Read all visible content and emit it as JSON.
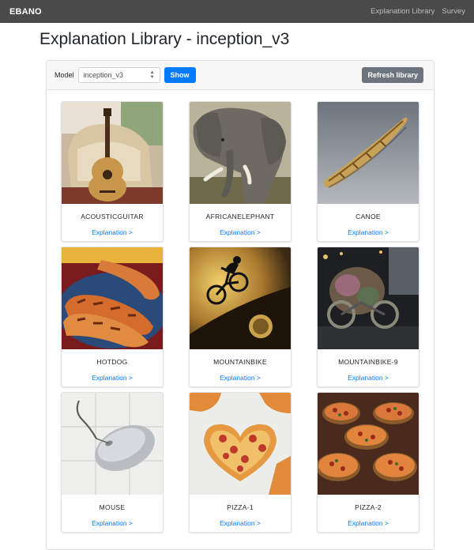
{
  "nav": {
    "brand": "EBANO",
    "links": [
      "Explanation Library",
      "Survey"
    ]
  },
  "page_title": "Explanation Library - inception_v3",
  "controls": {
    "model_label": "Model",
    "model_value": "inception_v3",
    "show_label": "Show",
    "refresh_label": "Refresh library"
  },
  "items": [
    {
      "label": "ACOUSTICGUITAR",
      "link": "Explanation >"
    },
    {
      "label": "AFRICANELEPHANT",
      "link": "Explanation >"
    },
    {
      "label": "CANOE",
      "link": "Explanation >"
    },
    {
      "label": "HOTDOG",
      "link": "Explanation >"
    },
    {
      "label": "MOUNTAINBIKE",
      "link": "Explanation >"
    },
    {
      "label": "MOUNTAINBIKE-9",
      "link": "Explanation >"
    },
    {
      "label": "MOUSE",
      "link": "Explanation >"
    },
    {
      "label": "PIZZA-1",
      "link": "Explanation >"
    },
    {
      "label": "PIZZA-2",
      "link": "Explanation >"
    }
  ],
  "colors": {
    "navbar": "#4a4a4a",
    "primary": "#007bff",
    "secondary": "#6c757d"
  }
}
